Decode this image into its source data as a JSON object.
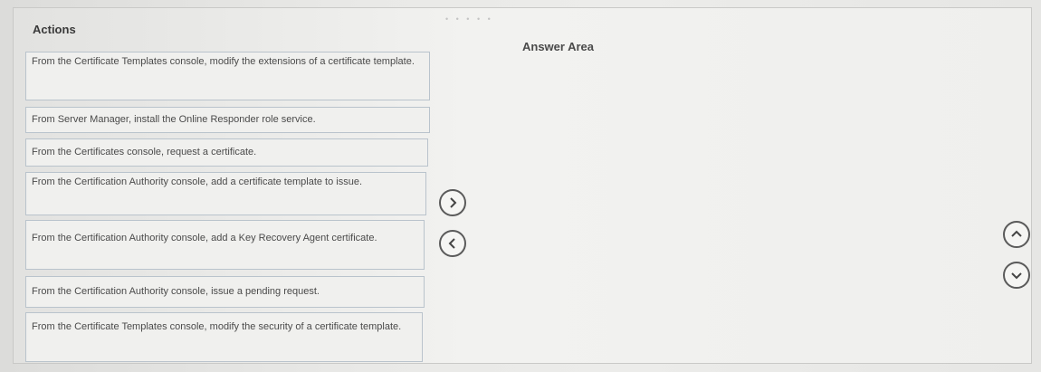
{
  "actions": {
    "title": "Actions",
    "items": [
      {
        "label": "From the Certificate Templates console, modify the extensions of a certificate template."
      },
      {
        "label": "From Server Manager, install the Online Responder role service."
      },
      {
        "label": "From the Certificates console, request a certificate."
      },
      {
        "label": "From the Certification Authority console, add a certificate template to issue."
      },
      {
        "label": "From the Certification Authority console, add a Key Recovery Agent certificate."
      },
      {
        "label": "From the Certification Authority console, issue a pending request."
      },
      {
        "label": "From the Certificate Templates console, modify the security of a certificate template."
      }
    ]
  },
  "answer_area": {
    "title": "Answer Area"
  },
  "controls": {
    "move_right_icon": "chevron-right-icon",
    "move_left_icon": "chevron-left-icon",
    "move_up_icon": "chevron-up-icon",
    "move_down_icon": "chevron-down-icon"
  }
}
